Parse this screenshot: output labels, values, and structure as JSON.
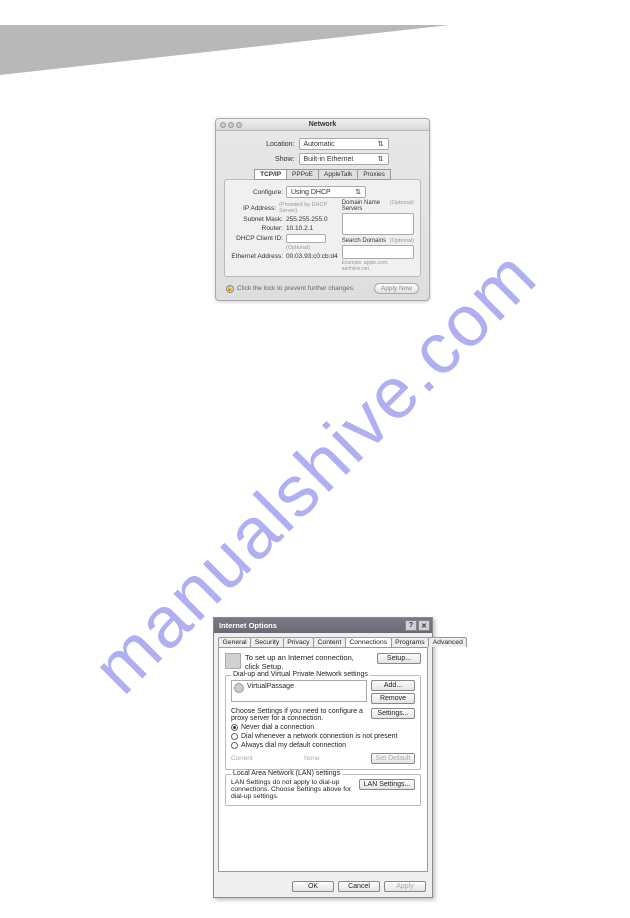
{
  "watermark": "manualshive.com",
  "mac": {
    "title": "Network",
    "location_label": "Location:",
    "location_value": "Automatic",
    "show_label": "Show:",
    "show_value": "Built-in Ethernet",
    "tabs": {
      "t1": "TCP/IP",
      "t2": "PPPoE",
      "t3": "AppleTalk",
      "t4": "Proxies"
    },
    "configure_label": "Configure:",
    "configure_value": "Using DHCP",
    "ip_label": "IP Address:",
    "ip_note": "(Provided by DHCP Server)",
    "subnet_label": "Subnet Mask:",
    "subnet_value": "255.255.255.0",
    "router_label": "Router:",
    "router_value": "10.10.2.1",
    "dhcp_label": "DHCP Client ID:",
    "dhcp_optional": "(Optional)",
    "eth_label": "Ethernet Address:",
    "eth_value": "00:03.93:c0:cb:d4",
    "dns_title": "Domain Name Servers",
    "dns_opt": "(Optional)",
    "search_title": "Search Domains",
    "search_opt": "(Optional)",
    "example": "Example: apple.com, earthlink.net",
    "lock_text": "Click the lock to prevent further changes.",
    "apply_btn": "Apply Now"
  },
  "win": {
    "title": "Internet Options",
    "tabs": {
      "general": "General",
      "security": "Security",
      "privacy": "Privacy",
      "content": "Content",
      "connections": "Connections",
      "programs": "Programs",
      "advanced": "Advanced"
    },
    "setup_text": "To set up an Internet connection, click Setup.",
    "setup_btn": "Setup...",
    "dialup_title": "Dial-up and Virtual Private Network settings",
    "vpn_item": "VirtualPassage",
    "add_btn": "Add...",
    "remove_btn": "Remove",
    "settings_btn": "Settings...",
    "proxy_text": "Choose Settings if you need to configure a proxy server for a connection.",
    "radio1": "Never dial a connection",
    "radio2": "Dial whenever a network connection is not present",
    "radio3": "Always dial my default connection",
    "current_label": "Current",
    "current_value": "None",
    "setdefault_btn": "Set Default",
    "lan_title": "Local Area Network (LAN) settings",
    "lan_text": "LAN Settings do not apply to dial-up connections. Choose Settings above for dial-up settings.",
    "lan_btn": "LAN Settings...",
    "ok_btn": "OK",
    "cancel_btn": "Cancel",
    "apply_btn": "Apply"
  }
}
